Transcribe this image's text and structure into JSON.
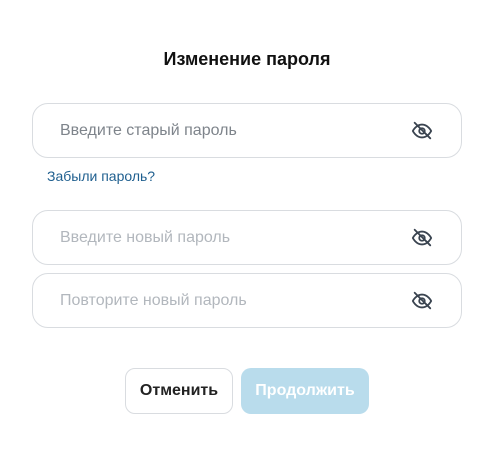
{
  "dialog": {
    "title": "Изменение пароля",
    "old_password": {
      "placeholder": "Введите старый пароль",
      "value": ""
    },
    "forgot_link": "Забыли пароль?",
    "new_password": {
      "placeholder": "Введите новый пароль",
      "value": ""
    },
    "repeat_password": {
      "placeholder": "Повторите новый пароль",
      "value": ""
    },
    "cancel_label": "Отменить",
    "continue_label": "Продолжить",
    "continue_enabled": false
  },
  "icons": {
    "visibility_toggle": "eye-off-icon"
  },
  "colors": {
    "link": "#1f5f8f",
    "continue_disabled_bg": "#b9dcec",
    "field_border": "#d9dce0"
  }
}
